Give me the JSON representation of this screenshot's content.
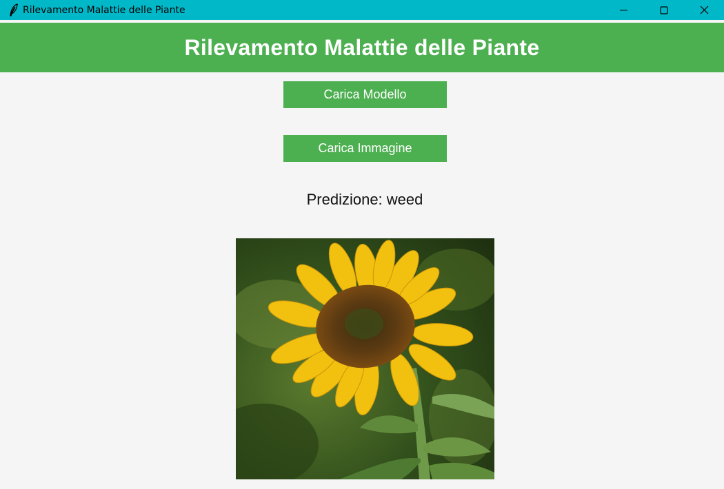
{
  "window": {
    "title": "Rilevamento Malattie delle Piante",
    "app_icon": "feather-icon",
    "controls": [
      "minimize-icon",
      "maximize-icon",
      "close-icon"
    ]
  },
  "header": {
    "title": "Rilevamento Malattie delle Piante"
  },
  "buttons": {
    "load_model": "Carica Modello",
    "load_image": "Carica Immagine"
  },
  "prediction": {
    "text": "Predizione: weed"
  },
  "colors": {
    "titlebar": "#00b8c8",
    "header": "#4caf50",
    "button": "#4caf50",
    "background": "#f4f5f4"
  }
}
